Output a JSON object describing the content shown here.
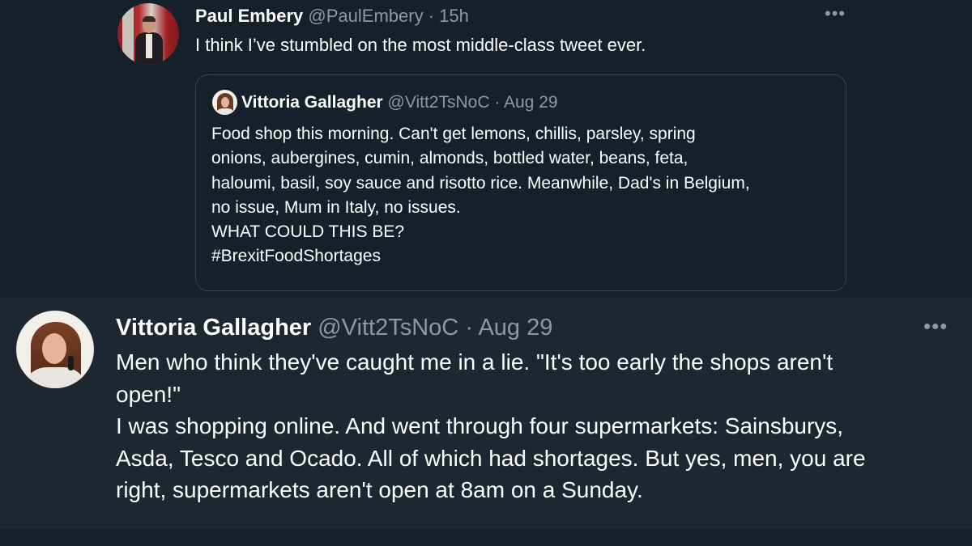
{
  "tweet1": {
    "avatar_icon": "user-avatar-icon",
    "name": "Paul Embery",
    "handle": "@PaulEmbery",
    "separator": "·",
    "time": "15h",
    "text": "I think I’ve stumbled on the most middle-class tweet ever.",
    "more_label": "•••"
  },
  "quote": {
    "name": "Vittoria Gallagher",
    "handle": "@Vitt2TsNoC",
    "separator": "·",
    "time": "Aug 29",
    "lines": [
      "Food shop this morning. Can't get lemons, chillis, parsley, spring",
      "onions, aubergines, cumin, almonds, bottled water, beans, feta,",
      "haloumi, basil, soy sauce and risotto rice. Meanwhile, Dad's in Belgium,",
      "no issue, Mum in Italy, no issues.",
      "WHAT COULD THIS BE?",
      "#BrexitFoodShortages"
    ]
  },
  "tweet2": {
    "name": "Vittoria Gallagher",
    "handle": "@Vitt2TsNoC",
    "separator": "·",
    "time": "Aug 29",
    "more_label": "•••",
    "lines": [
      "Men who think they've caught me in a lie. \"It's too early the shops aren't",
      "open!\"",
      "I was shopping online. And went through four supermarkets: Sainsburys,",
      "Asda, Tesco and Ocado. All of which had shortages. But yes, men, you are",
      "right, supermarkets aren't open at 8am on a Sunday."
    ]
  },
  "colors": {
    "background": "#15202b",
    "highlight_background": "#1c2732",
    "text": "#ffffff",
    "muted": "#8b98a5",
    "border": "#38444d"
  }
}
